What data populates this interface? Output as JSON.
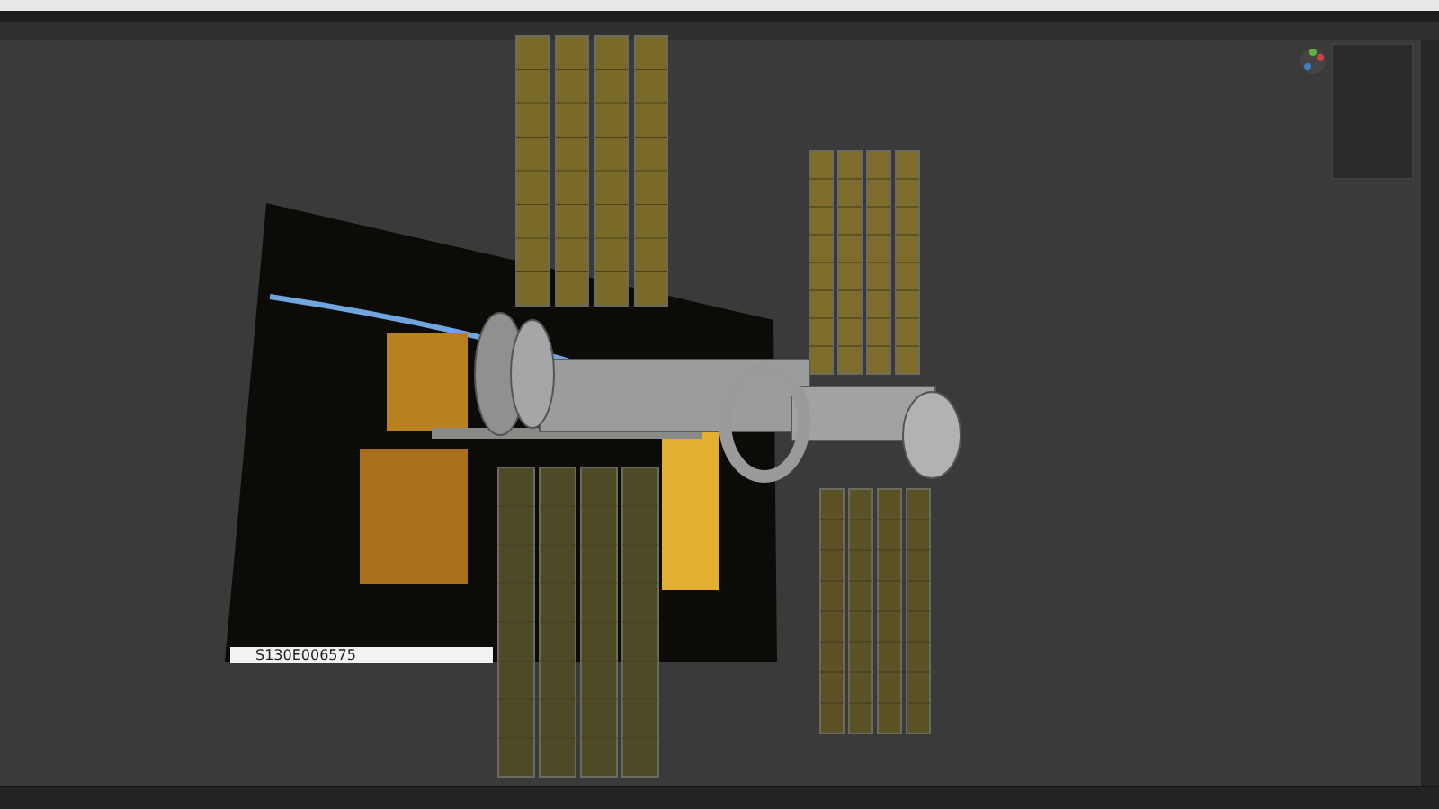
{
  "viewport": {
    "image_caption": "S130E006575"
  }
}
